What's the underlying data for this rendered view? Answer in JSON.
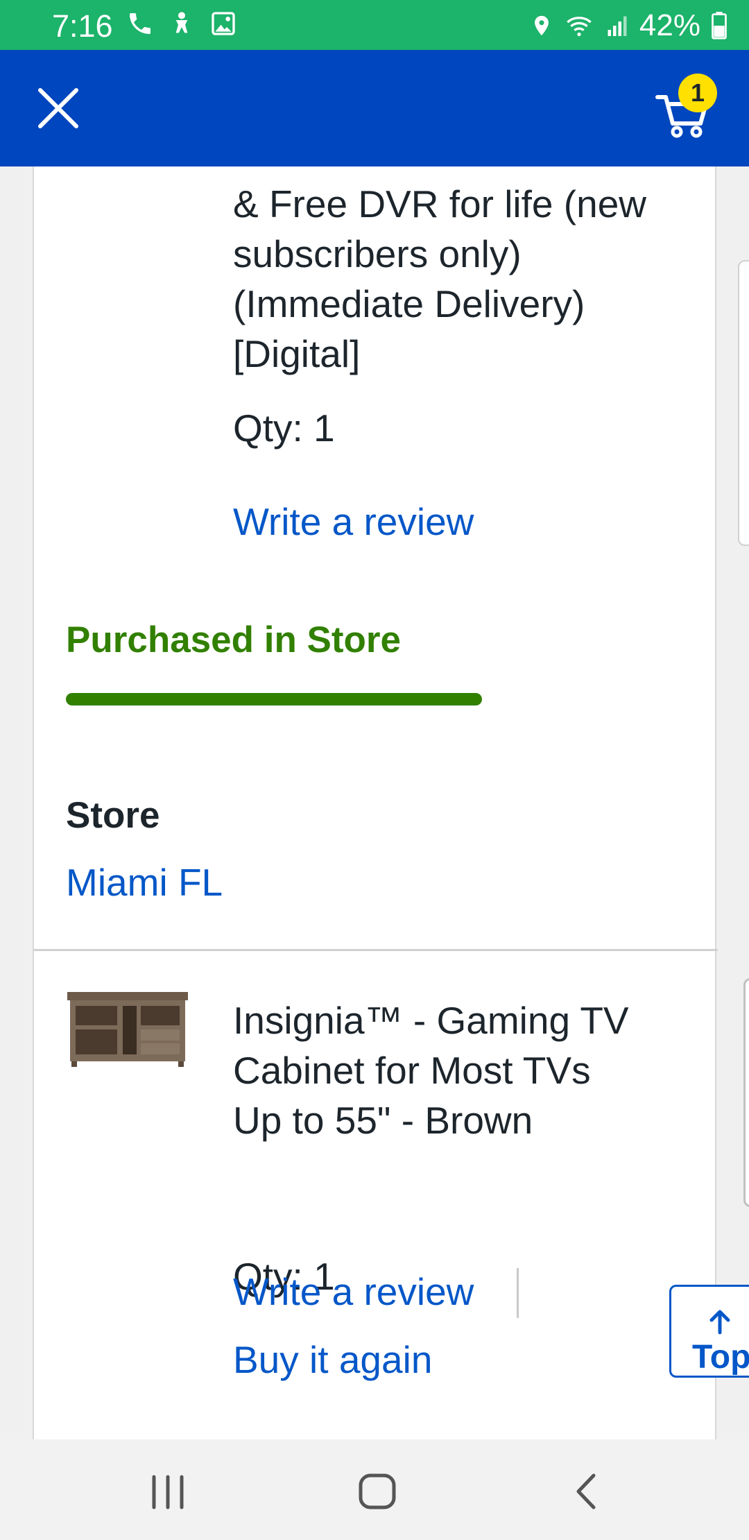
{
  "status_bar": {
    "time": "7:16",
    "battery": "42%",
    "icons_left": [
      "phone-icon",
      "accessibility-icon",
      "gallery-icon"
    ],
    "icons_right": [
      "location-icon",
      "wifi-icon",
      "signal-icon",
      "battery-icon"
    ]
  },
  "header": {
    "close_icon": "close-icon",
    "cart_icon": "cart-icon",
    "cart_count": "1",
    "colors": {
      "background": "#0046be",
      "badge": "#ffe000"
    }
  },
  "order": {
    "item1": {
      "description_lines": [
        "& Free DVR for life (new",
        "subscribers only)",
        "(Immediate Delivery)",
        "[Digital]"
      ],
      "qty": "Qty: 1",
      "write_review": "Write a review"
    },
    "fulfillment": {
      "title": "Purchased in Store",
      "color": "#318000",
      "store_label": "Store",
      "store_value": "Miami FL"
    },
    "item2": {
      "title_lines": [
        "Insignia™ - Gaming TV",
        "Cabinet for Most TVs",
        "Up to 55\" - Brown"
      ],
      "qty": "Qty: 1",
      "write_review": "Write a review",
      "buy_again": "Buy it again",
      "image_icon": "tv-cabinet-image"
    }
  },
  "top_button": {
    "label": "Top",
    "icon": "arrow-up-icon"
  },
  "nav": {
    "recents": "recents-icon",
    "home": "home-icon",
    "back": "back-icon"
  }
}
